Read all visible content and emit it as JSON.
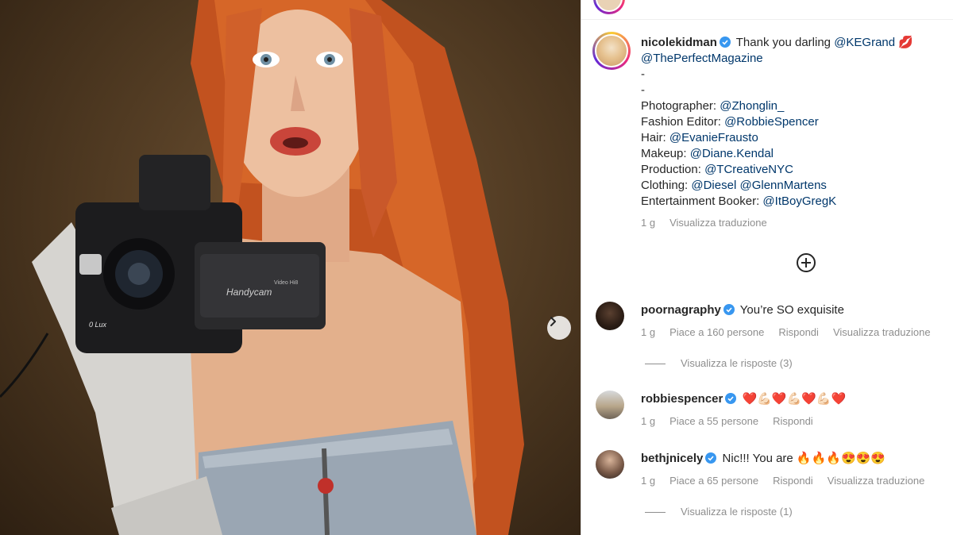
{
  "post": {
    "author": "nicolekidman",
    "caption_intro": "Thank you darling",
    "caption_mention_1": "@KEGrand",
    "caption_emoji": "💋",
    "caption_mention_2": "@ThePerfectMagazine",
    "dash_1": "-",
    "dash_2": "-",
    "credits": [
      {
        "label": "Photographer:",
        "mentions": [
          "@Zhonglin_"
        ]
      },
      {
        "label": "Fashion Editor:",
        "mentions": [
          "@RobbieSpencer"
        ]
      },
      {
        "label": "Hair:",
        "mentions": [
          "@EvanieFrausto"
        ]
      },
      {
        "label": "Makeup:",
        "mentions": [
          "@Diane.Kendal"
        ]
      },
      {
        "label": "Production:",
        "mentions": [
          "@TCreativeNYC"
        ]
      },
      {
        "label": "Clothing:",
        "mentions": [
          "@Diesel",
          "@GlennMartens"
        ]
      },
      {
        "label": "Entertainment Booker:",
        "mentions": [
          "@ItBoyGregK"
        ]
      }
    ],
    "time": "1 g",
    "translate_label": "Visualizza traduzione"
  },
  "photo": {
    "camera_brand": "Handycam",
    "camera_sub": "Video Hi8",
    "camera_lux": "0 Lux"
  },
  "comments": [
    {
      "user": "poornagraphy",
      "text": "You’re SO exquisite",
      "time": "1 g",
      "likes": "Piace a 160 persone",
      "reply": "Rispondi",
      "translate": "Visualizza traduzione",
      "view_replies": "Visualizza le risposte (3)"
    },
    {
      "user": "robbiespencer",
      "text": "❤️💪🏻❤️💪🏻❤️💪🏻❤️",
      "time": "1 g",
      "likes": "Piace a 55 persone",
      "reply": "Rispondi"
    },
    {
      "user": "bethjnicely",
      "text": "Nic!!! You are 🔥🔥🔥😍😍😍",
      "time": "1 g",
      "likes": "Piace a 65 persone",
      "reply": "Rispondi",
      "translate": "Visualizza traduzione",
      "view_replies": "Visualizza le risposte (1)"
    }
  ],
  "colors": {
    "verified": "#3897f0",
    "mention": "#00376b",
    "meta": "#8e8e8e"
  }
}
